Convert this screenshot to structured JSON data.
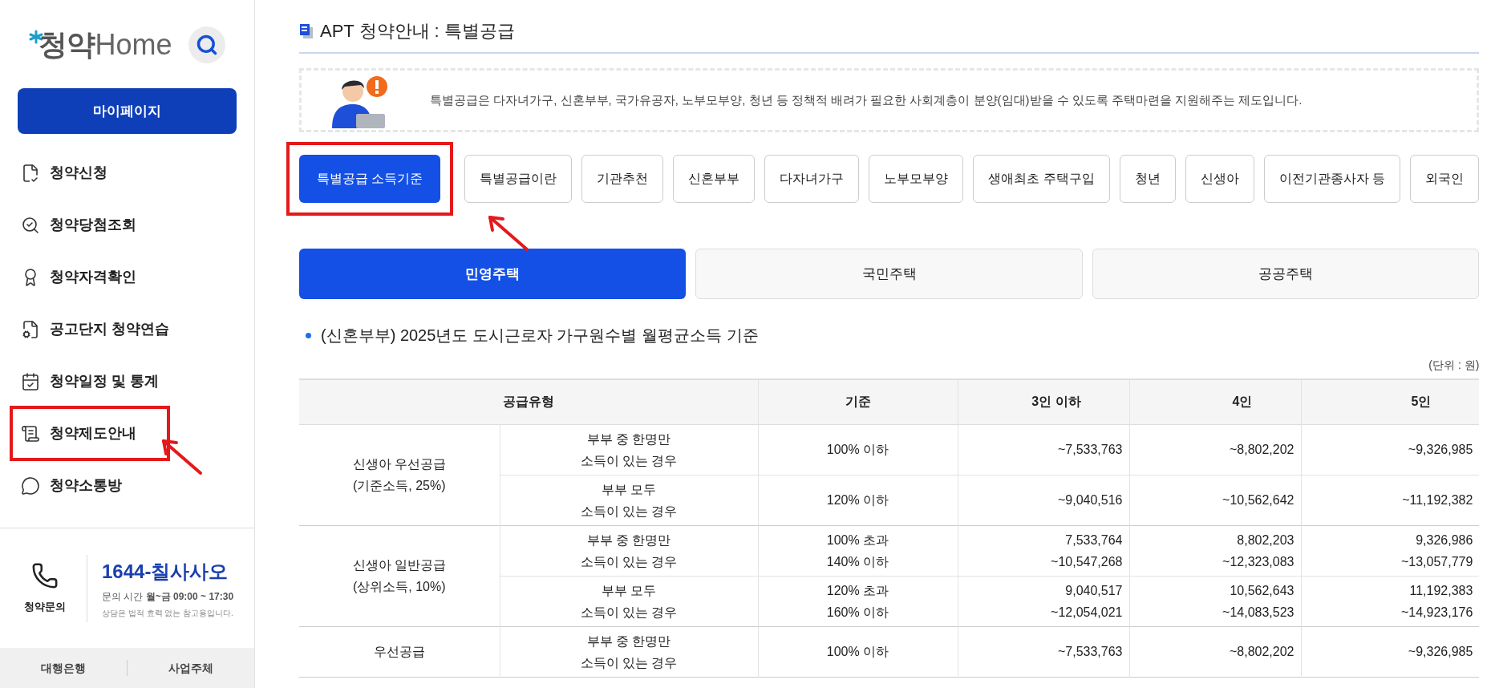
{
  "sidebar": {
    "logo": {
      "prefix": "청약",
      "suffix": "Home"
    },
    "mypage_button": "마이페이지",
    "menu": [
      {
        "kind": "apply",
        "label": "청약신청",
        "annotated": false
      },
      {
        "kind": "result",
        "label": "청약당첨조회",
        "annotated": false
      },
      {
        "kind": "qualify",
        "label": "청약자격확인",
        "annotated": false
      },
      {
        "kind": "practice",
        "label": "공고단지 청약연습",
        "annotated": false
      },
      {
        "kind": "calendar",
        "label": "청약일정 및 통계",
        "annotated": false
      },
      {
        "kind": "guide",
        "label": "청약제도안내",
        "annotated": true
      },
      {
        "kind": "chat",
        "label": "청약소통방",
        "annotated": false
      }
    ],
    "contact": {
      "label": "청약문의",
      "phone": "1644-칠사사오",
      "hours": "문의 시간 **월~금 09:00 ~ 17:30**",
      "note": "상담은 법적 효력 없는 참고용입니다."
    },
    "bottom_links": [
      "대행은행",
      "사업주체"
    ]
  },
  "page_title": "APT 청약안내 : 특별공급",
  "intro": "특별공급은 다자녀가구, 신혼부부, 국가유공자, 노부모부양, 청년 등 정책적 배려가 필요한 사회계층이 분양(임대)받을 수 있도록 주택마련을 지원해주는 제도입니다.",
  "tabs": [
    {
      "label": "특별공급 소득기준",
      "selected": true,
      "annotated": true
    },
    {
      "label": "특별공급이란",
      "selected": false,
      "annotated": false
    },
    {
      "label": "기관추천",
      "selected": false,
      "annotated": false
    },
    {
      "label": "신혼부부",
      "selected": false,
      "annotated": false
    },
    {
      "label": "다자녀가구",
      "selected": false,
      "annotated": false
    },
    {
      "label": "노부모부양",
      "selected": false,
      "annotated": false
    },
    {
      "label": "생애최초 주택구입",
      "selected": false,
      "annotated": false
    },
    {
      "label": "청년",
      "selected": false,
      "annotated": false
    },
    {
      "label": "신생아",
      "selected": false,
      "annotated": false
    },
    {
      "label": "이전기관종사자 등",
      "selected": false,
      "annotated": false
    },
    {
      "label": "외국인",
      "selected": false,
      "annotated": false
    }
  ],
  "sub_tabs": [
    {
      "label": "민영주택",
      "selected": true
    },
    {
      "label": "국민주택",
      "selected": false
    },
    {
      "label": "공공주택",
      "selected": false
    }
  ],
  "section_heading": "(신혼부부) 2025년도 도시근로자 가구원수별 월평균소득 기준",
  "unit": "(단위 : 원)",
  "table": {
    "columns": [
      "공급유형",
      "기준",
      "3인 이하",
      "4인",
      "5인"
    ],
    "groups": [
      {
        "type": [
          "신생아 우선공급",
          "(기준소득, 25%)"
        ],
        "rows": [
          {
            "condition": [
              "부부 중 한명만",
              "소득이 있는 경우"
            ],
            "standard": [
              "100% 이하"
            ],
            "values": [
              [
                "~7,533,763"
              ],
              [
                "~8,802,202"
              ],
              [
                "~9,326,985"
              ]
            ]
          },
          {
            "condition": [
              "부부 모두",
              "소득이 있는 경우"
            ],
            "standard": [
              "120% 이하"
            ],
            "values": [
              [
                "~9,040,516"
              ],
              [
                "~10,562,642"
              ],
              [
                "~11,192,382"
              ]
            ]
          }
        ]
      },
      {
        "type": [
          "신생아 일반공급",
          "(상위소득, 10%)"
        ],
        "rows": [
          {
            "condition": [
              "부부 중 한명만",
              "소득이 있는 경우"
            ],
            "standard": [
              "100% 초과",
              "140% 이하"
            ],
            "values": [
              [
                "7,533,764",
                "~10,547,268"
              ],
              [
                "8,802,203",
                "~12,323,083"
              ],
              [
                "9,326,986",
                "~13,057,779"
              ]
            ]
          },
          {
            "condition": [
              "부부 모두",
              "소득이 있는 경우"
            ],
            "standard": [
              "120% 초과",
              "160% 이하"
            ],
            "values": [
              [
                "9,040,517",
                "~12,054,021"
              ],
              [
                "10,562,643",
                "~14,083,523"
              ],
              [
                "11,192,383",
                "~14,923,176"
              ]
            ]
          }
        ]
      },
      {
        "type": [
          "우선공급"
        ],
        "rows": [
          {
            "condition": [
              "부부 중 한명만",
              "소득이 있는 경우"
            ],
            "standard": [
              "100% 이하"
            ],
            "values": [
              [
                "~7,533,763"
              ],
              [
                "~8,802,202"
              ],
              [
                "~9,326,985"
              ]
            ]
          }
        ]
      }
    ]
  }
}
